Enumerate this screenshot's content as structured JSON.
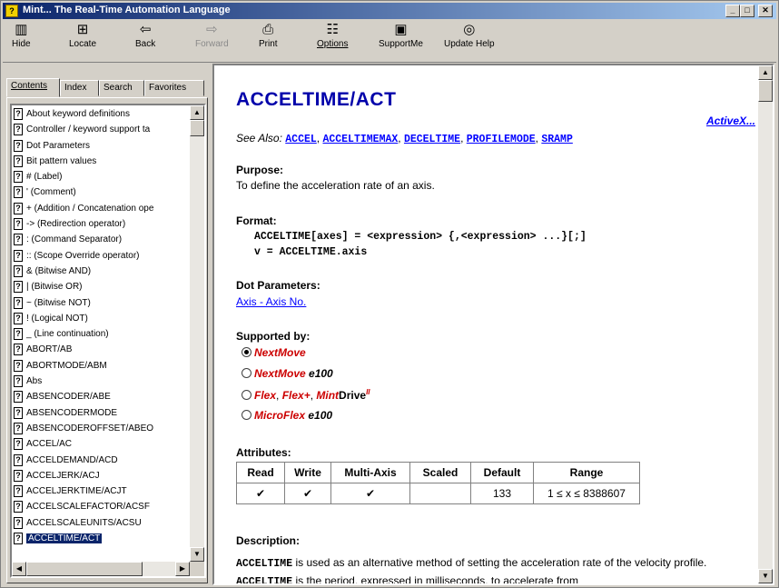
{
  "window": {
    "title": "Mint... The Real-Time Automation Language"
  },
  "toolbar": {
    "hide": "Hide",
    "locate": "Locate",
    "back": "Back",
    "forward": "Forward",
    "print": "Print",
    "options": "Options",
    "supportme": "SupportMe",
    "update_help": "Update Help"
  },
  "tabs": [
    "Contents",
    "Index",
    "Search",
    "Favorites"
  ],
  "topics": [
    "About keyword definitions",
    "Controller / keyword support ta",
    "Dot Parameters",
    "Bit pattern values",
    "#   (Label)",
    "'     (Comment)",
    "+  (Addition / Concatenation ope",
    "-> (Redirection operator)",
    ":    (Command Separator)",
    "::  (Scope Override operator)",
    "&  (Bitwise AND)",
    "|    (Bitwise OR)",
    "~   (Bitwise NOT)",
    "!    (Logical NOT)",
    "_    (Line continuation)",
    "ABORT/AB",
    "ABORTMODE/ABM",
    "Abs",
    "ABSENCODER/ABE",
    "ABSENCODERMODE",
    "ABSENCODEROFFSET/ABEO",
    "ACCEL/AC",
    "ACCELDEMAND/ACD",
    "ACCELJERK/ACJ",
    "ACCELJERKTIME/ACJT",
    "ACCELSCALEFACTOR/ACSF",
    "ACCELSCALEUNITS/ACSU",
    "ACCELTIME/ACT"
  ],
  "page": {
    "heading": "ACCELTIME/ACT",
    "activex": "ActiveX...",
    "see_also_label": "See Also:",
    "see_also": [
      "ACCEL",
      "ACCELTIMEMAX",
      "DECELTIME",
      "PROFILEMODE",
      "SRAMP"
    ],
    "purpose_h": "Purpose:",
    "purpose": "To define the acceleration rate of an axis.",
    "format_h": "Format:",
    "format_1": "ACCELTIME[axes] = <expression> {,<expression> ...}[;]",
    "format_2": "v = ACCELTIME.axis",
    "dot_h": "Dot Parameters:",
    "dot_link": "Axis - Axis No.",
    "supported_h": "Supported by:",
    "supported": {
      "s1": "NextMove",
      "s2a": "NextMove",
      "s2b": " e100",
      "s3a": "Flex",
      "s3b": "Flex+",
      "s3c": "Mint",
      "s3d": "Drive",
      "s3e": "II",
      "s4a": "MicroFlex",
      "s4b": " e100"
    },
    "attributes_h": "Attributes:",
    "attr_headers": [
      "Read",
      "Write",
      "Multi-Axis",
      "Scaled",
      "Default",
      "Range"
    ],
    "attr_values": [
      "✔",
      "✔",
      "✔",
      "",
      "133",
      "1 ≤ x ≤ 8388607"
    ],
    "description_h": "Description:",
    "desc_kw1": "ACCELTIME",
    "desc_1": " is used as an alternative method of setting the acceleration rate of the velocity profile. ",
    "desc_kw2": "ACCELTIME",
    "desc_2": " is the period, expressed in milliseconds, to accelerate from"
  }
}
